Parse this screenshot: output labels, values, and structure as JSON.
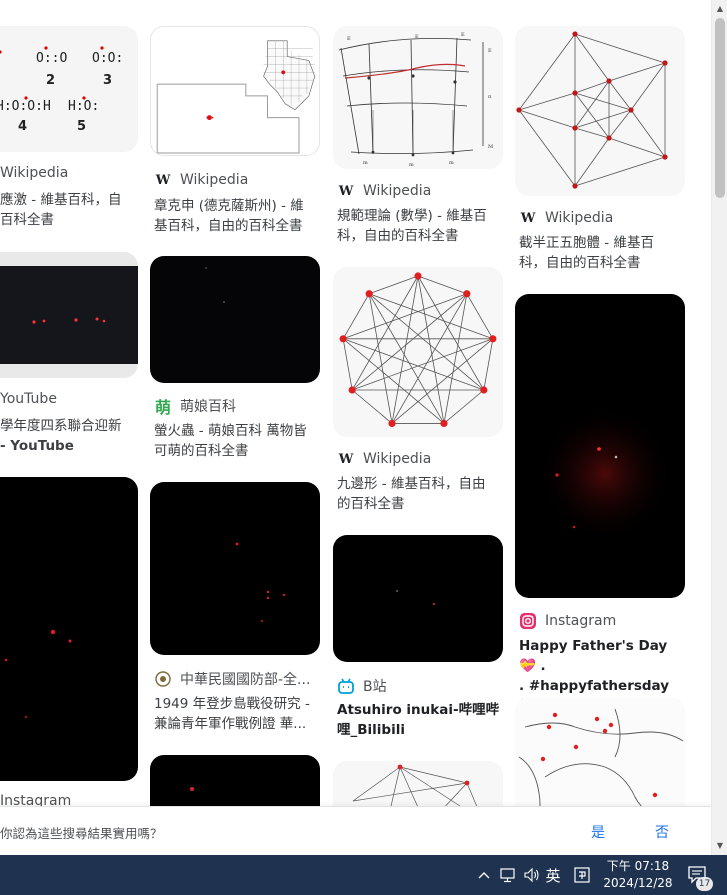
{
  "results": {
    "col0": [
      {
        "source": "Wikipedia",
        "title_lines": [
          "應激 - 維基百科，自",
          "百科全書"
        ]
      },
      {
        "source": "YouTube",
        "title_lines": [
          "學年度四系聯合迎新",
          " - YouTube"
        ]
      },
      {
        "source": "Instagram",
        "title_lines": []
      }
    ],
    "col1": [
      {
        "source": "Wikipedia",
        "title_lines": [
          "章克申 (德克薩斯州) - 維",
          "基百科，自由的百科全書"
        ]
      },
      {
        "source": "萌娘百科",
        "title_lines": [
          "螢火蟲 - 萌娘百科 萬物皆",
          "可萌的百科全書"
        ]
      },
      {
        "source": "中華民國國防部-全...",
        "title_lines": [
          "1949 年登步島戰役研究 -",
          "兼論青年軍作戰例證 華..."
        ]
      }
    ],
    "col2": [
      {
        "source": "Wikipedia",
        "title_lines": [
          "規範理論 (數學) - 維基百",
          "科，自由的百科全書"
        ]
      },
      {
        "source": "Wikipedia",
        "title_lines": [
          "九邊形 - 維基百科，自由",
          "的百科全書"
        ]
      },
      {
        "source": "B站",
        "title_lines": [
          "Atsuhiro inukai-哔哩哔",
          "哩_Bilibili"
        ]
      }
    ],
    "col3": [
      {
        "source": "Wikipedia",
        "title_lines": [
          "截半正五胞體 - 維基百",
          "科，自由的百科全書"
        ]
      },
      {
        "source": "Instagram",
        "title_lines": [
          "Happy Father's Day 💝 .",
          ". #happyfathersday❤️..."
        ]
      }
    ]
  },
  "thumb_text": {
    "lewis_labels": [
      "2",
      "3",
      "4",
      "5"
    ],
    "lewis_formulas": [
      "O::O",
      "O:O:",
      "H:O:O:H",
      "H:O:"
    ]
  },
  "feedback": {
    "question": "你認為這些搜尋結果實用嗎？",
    "yes": "是",
    "no": "否"
  },
  "taskbar": {
    "ime": "英",
    "time": "下午 07:18",
    "date": "2024/12/28",
    "notifications": "17"
  },
  "colors": {
    "wiki": "#202124",
    "youtube_red": "#ff0000",
    "moegirl_green": "#34a853",
    "bilibili_blue": "#00a1d6",
    "instagram_pink": "#e1306c",
    "link_blue": "#1a73e8",
    "taskbar": "#1f3350"
  }
}
